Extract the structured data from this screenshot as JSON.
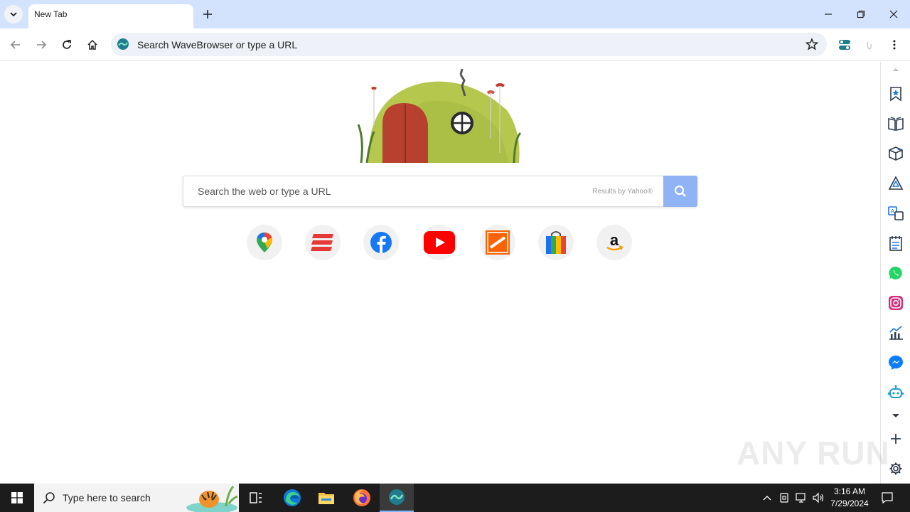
{
  "tab": {
    "title": "New Tab"
  },
  "omnibox": {
    "placeholder": "Search WaveBrowser or type a URL"
  },
  "search": {
    "placeholder": "Search the web or type a URL",
    "results_by": "Results by Yahoo®"
  },
  "shortcuts": [
    {
      "icon": "google-maps-icon"
    },
    {
      "icon": "red-stripes-icon"
    },
    {
      "icon": "facebook-icon"
    },
    {
      "icon": "youtube-icon"
    },
    {
      "icon": "home-depot-icon"
    },
    {
      "icon": "shopping-bag-icon"
    },
    {
      "icon": "amazon-icon"
    }
  ],
  "sidepanel": [
    "bookmark-star-icon",
    "open-book-icon",
    "package-box-icon",
    "recycle-triangle-icon",
    "translate-icon",
    "notepad-icon",
    "whatsapp-icon",
    "instagram-icon",
    "stock-chart-icon",
    "messenger-icon",
    "robot-icon",
    "chevron-down-icon",
    "plus-icon",
    "gear-icon"
  ],
  "watermark": {
    "text": "ANY RUN"
  },
  "taskbar": {
    "search_placeholder": "Type here to search",
    "time": "3:16 AM",
    "date": "7/29/2024"
  },
  "colors": {
    "tabstrip": "#d3e3fd",
    "search_button": "#8fb3f5",
    "taskbar": "#1c1c1c",
    "accent": "#1a73e8"
  }
}
